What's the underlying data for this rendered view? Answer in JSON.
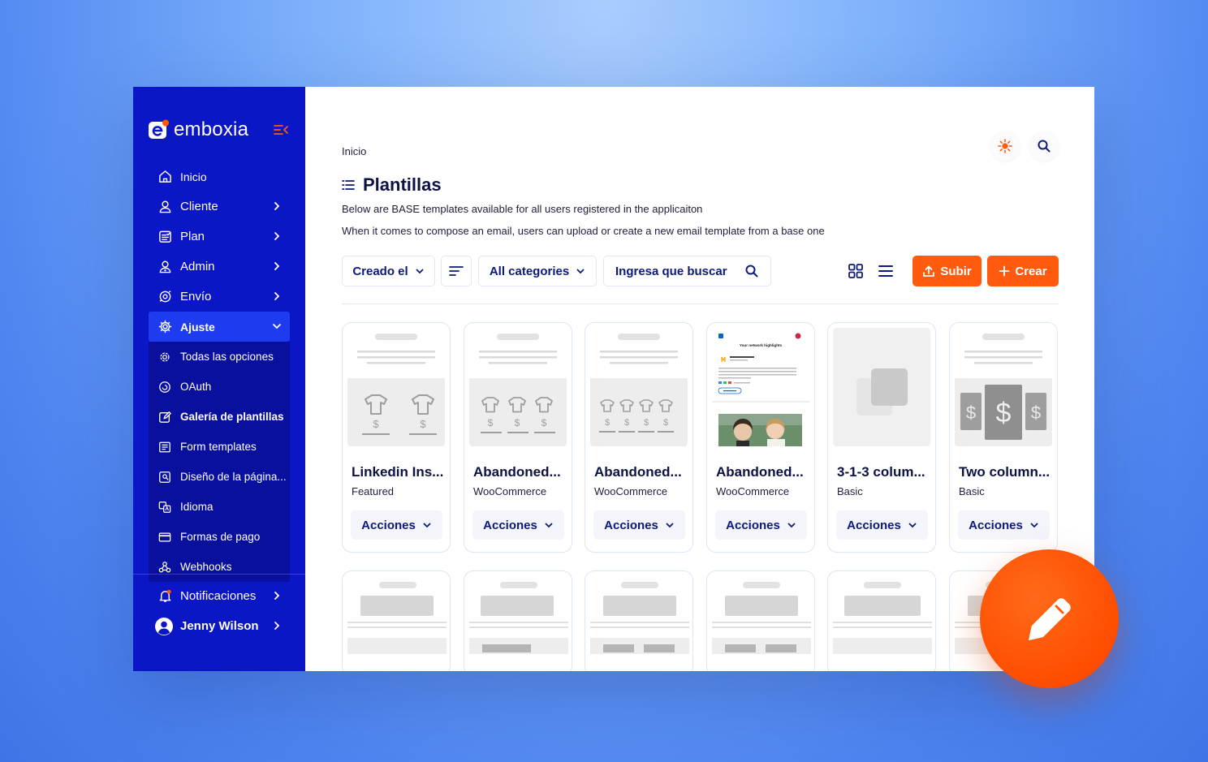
{
  "app": {
    "name": "emboxia"
  },
  "colors": {
    "sidebar": "#0b16c6",
    "accent": "#ff5a0d",
    "active": "#1f3bef"
  },
  "sidebar": {
    "items": [
      {
        "label": "Inicio",
        "icon": "home-icon",
        "chevron": false
      },
      {
        "label": "Cliente",
        "icon": "user-icon",
        "chevron": true
      },
      {
        "label": "Plan",
        "icon": "plan-icon",
        "chevron": true
      },
      {
        "label": "Admin",
        "icon": "admin-icon",
        "chevron": true
      },
      {
        "label": "Envío",
        "icon": "send-icon",
        "chevron": true
      },
      {
        "label": "Ajuste",
        "icon": "settings-icon",
        "chevron": true
      }
    ],
    "submenu": [
      {
        "label": "Todas las opciones",
        "icon": "gear-icon"
      },
      {
        "label": "OAuth",
        "icon": "oauth-icon"
      },
      {
        "label": "Galería de plantillas",
        "icon": "edit-icon"
      },
      {
        "label": "Form templates",
        "icon": "form-icon"
      },
      {
        "label": "Diseño de la página...",
        "icon": "page-design-icon"
      },
      {
        "label": "Idioma",
        "icon": "language-icon"
      },
      {
        "label": "Formas de pago",
        "icon": "card-icon"
      },
      {
        "label": "Webhooks",
        "icon": "webhook-icon"
      }
    ],
    "notifications": "Notificaciones",
    "user": "Jenny Wilson"
  },
  "main": {
    "breadcrumb": "Inicio",
    "title": "Plantillas",
    "desc1": "Below are BASE templates available for all users registered in the applicaiton",
    "desc2": "When it comes to compose an email, users can upload or create a new email template from a base one",
    "toolbar": {
      "sort_label": "Creado el",
      "category_label": "All categories",
      "search_placeholder": "Ingresa que buscar",
      "upload_label": "Subir",
      "create_label": "Crear"
    },
    "cards": [
      {
        "title": "Linkedin Ins...",
        "sub": "Featured",
        "action": "Acciones"
      },
      {
        "title": "Abandoned...",
        "sub": "WooCommerce",
        "action": "Acciones"
      },
      {
        "title": "Abandoned...",
        "sub": "WooCommerce",
        "action": "Acciones"
      },
      {
        "title": "Abandoned...",
        "sub": "WooCommerce",
        "action": "Acciones"
      },
      {
        "title": "3-1-3 colum...",
        "sub": "Basic",
        "action": "Acciones"
      },
      {
        "title": "Two column...",
        "sub": "Basic",
        "action": "Acciones"
      }
    ],
    "thumb4": {
      "heading": "Your network highlights"
    }
  }
}
